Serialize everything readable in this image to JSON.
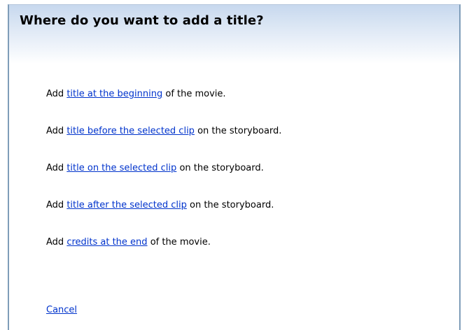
{
  "dialog": {
    "title": "Where do you want to add a title?",
    "options": [
      {
        "prefix": "Add",
        "link": "title at the beginning",
        "suffix": "of the movie."
      },
      {
        "prefix": "Add",
        "link": "title before the selected clip",
        "suffix": "on the storyboard."
      },
      {
        "prefix": "Add",
        "link": "title on the selected clip",
        "suffix": "on the storyboard."
      },
      {
        "prefix": "Add",
        "link": "title after the selected clip",
        "suffix": "on the storyboard."
      },
      {
        "prefix": "Add",
        "link": "credits at the end",
        "suffix": "of the movie."
      }
    ],
    "cancel_label": "Cancel"
  },
  "colors": {
    "link": "#0033cc",
    "border": "#7f9db9",
    "header_gradient_top": "#c7d8ee"
  }
}
